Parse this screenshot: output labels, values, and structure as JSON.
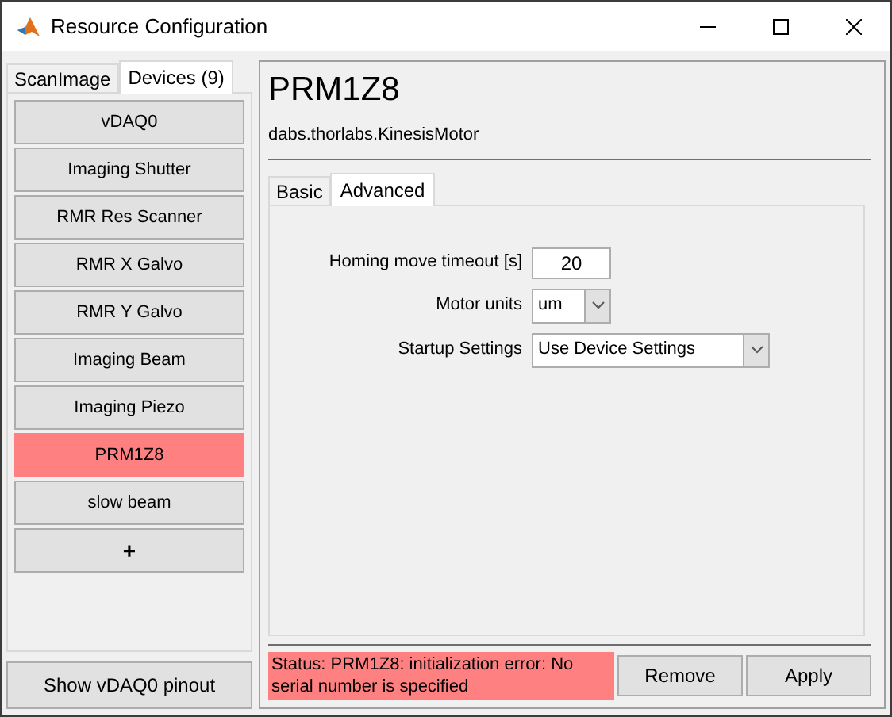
{
  "window": {
    "title": "Resource Configuration"
  },
  "left_tabs": [
    {
      "label": "ScanImage",
      "selected": false
    },
    {
      "label": "Devices (9)",
      "selected": true
    }
  ],
  "devices": [
    {
      "label": "vDAQ0",
      "selected": false
    },
    {
      "label": "Imaging Shutter",
      "selected": false
    },
    {
      "label": "RMR Res Scanner",
      "selected": false
    },
    {
      "label": "RMR X Galvo",
      "selected": false
    },
    {
      "label": "RMR Y Galvo",
      "selected": false
    },
    {
      "label": "Imaging Beam",
      "selected": false
    },
    {
      "label": "Imaging Piezo",
      "selected": false
    },
    {
      "label": "PRM1Z8",
      "selected": true
    },
    {
      "label": "slow beam",
      "selected": false
    }
  ],
  "add_button": "+",
  "pinout_button": "Show vDAQ0 pinout",
  "device": {
    "name": "PRM1Z8",
    "class": "dabs.thorlabs.KinesisMotor"
  },
  "device_tabs": [
    {
      "label": "Basic",
      "selected": false
    },
    {
      "label": "Advanced",
      "selected": true
    }
  ],
  "fields": [
    {
      "kind": "text",
      "label": "Homing move timeout [s]",
      "value": "20"
    },
    {
      "kind": "select",
      "label": "Motor units",
      "value": "um"
    },
    {
      "kind": "select",
      "label": "Startup Settings",
      "value": "Use Device Settings"
    }
  ],
  "status": "Status: PRM1Z8: initialization error: No serial number is specified",
  "buttons": [
    "Remove",
    "Apply"
  ]
}
